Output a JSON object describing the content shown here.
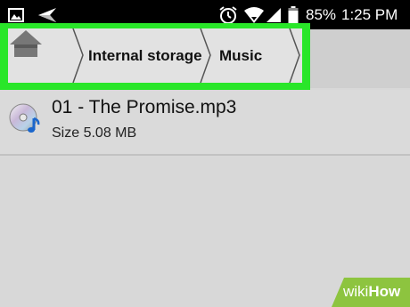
{
  "status_bar": {
    "battery_percent": "85%",
    "time": "1:25 PM",
    "left_icons": [
      "image-icon",
      "send-icon"
    ],
    "right_icons": [
      "alarm-clock-icon",
      "wifi-icon",
      "signal-icon",
      "battery-icon"
    ]
  },
  "breadcrumb": {
    "home_icon": "home-icon",
    "items": [
      {
        "label": "Internal storage"
      },
      {
        "label": "Music"
      }
    ]
  },
  "files": [
    {
      "icon": "music-disc-icon",
      "name": "01 - The Promise.mp3",
      "size": "Size 5.08 MB"
    }
  ],
  "watermark": {
    "prefix": "wiki",
    "suffix": "How"
  },
  "colors": {
    "highlight": "#29e629",
    "status_bar": "#000000",
    "breadcrumb_bg": "#e2e2e2",
    "page_bg": "#d8d8d8"
  }
}
